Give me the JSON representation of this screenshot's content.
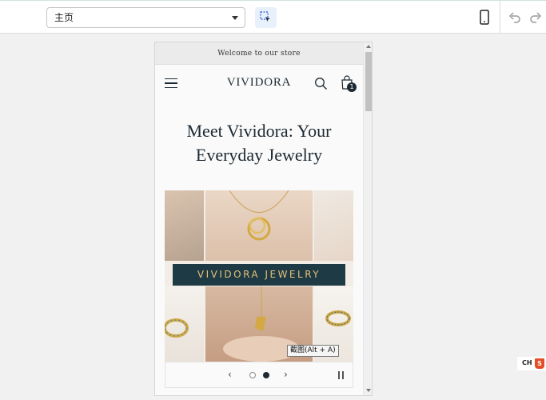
{
  "toolbar": {
    "page_select_value": "主页",
    "icons": [
      "inspect-select-icon",
      "mobile-device-icon",
      "undo-icon",
      "redo-icon"
    ]
  },
  "preview": {
    "announcement": "Welcome to our store",
    "logo": "VIVIDORA",
    "cart_count": "1",
    "heading": "Meet Vividora: Your Everyday Jewelry",
    "slide_banner": "VIVIDORA JEWELRY",
    "slider": {
      "active_slide": 2,
      "total_slides": 2,
      "prev_symbol": "‹",
      "next_symbol": "›"
    }
  },
  "tooltip": "截图(Alt + A)",
  "ime": {
    "label": "CH",
    "icon_letter": "S"
  },
  "colors": {
    "accent": "#1e3a45",
    "banner_text": "#e4c078",
    "inspect_bg": "#e8f0fc"
  }
}
